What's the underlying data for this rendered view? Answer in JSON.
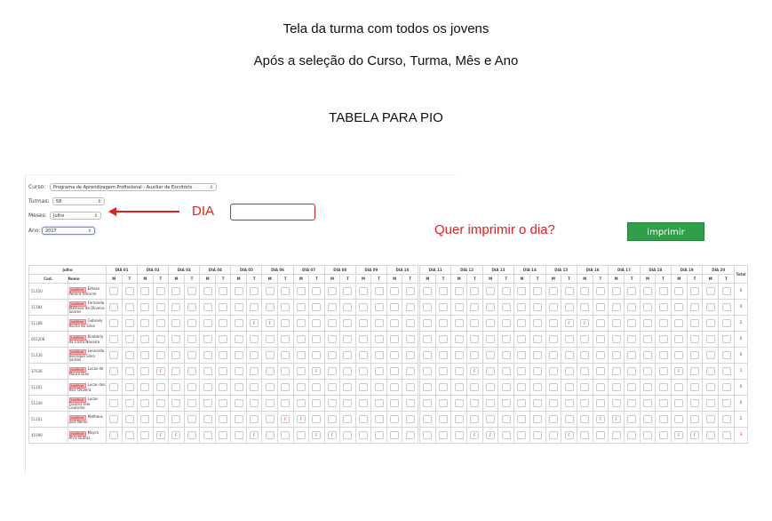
{
  "headings": {
    "line1": "Tela da turma com todos os jovens",
    "line2": "Após a seleção do Curso, Turma, Mês e Ano",
    "line3": "TABELA PARA PIO"
  },
  "filters": {
    "curso_label": "Curso:",
    "curso_value": "Programa de Aprendizagem Profissional - Auxiliar de Escritório",
    "turmas_label": "Turmas:",
    "turmas_value": "58",
    "meses_label": "Meses:",
    "meses_value": "Julho",
    "ano_label": "Ano:",
    "ano_value": "2017"
  },
  "annotation": {
    "dia_label": "DIA",
    "question": "Quer imprimir o dia?",
    "print_button": "imprimir"
  },
  "table": {
    "month": "Julho",
    "code_header": "Cod.",
    "name_header": "Nome",
    "total_header": "Total",
    "shift_m": "M",
    "shift_t": "T",
    "badge": "Justificar",
    "mark": "F",
    "left_days": [
      "DIA 01",
      "DIA 02",
      "DIA 03",
      "DIA 04",
      "DIA 05",
      "DIA 06",
      "DIA 07",
      "DIA 08",
      "DIA 09",
      "DIA 10"
    ],
    "right_days": [
      "DIA 11",
      "DIA 12",
      "DIA 13",
      "DIA 14",
      "DIA 15",
      "DIA 16",
      "DIA 17",
      "DIA 18",
      "DIA 19",
      "DIA 20"
    ],
    "students": [
      {
        "code": "51150",
        "name": "Edivan Pereira Amorim",
        "total": "0"
      },
      {
        "code": "51184",
        "name": "Fernando Matheus de Oliveira Soares",
        "total": "0"
      },
      {
        "code": "51188",
        "name": "Gabriely Rocha da Silva",
        "total": "2"
      },
      {
        "code": "001208",
        "name": "Kimberly da Costa Navarro",
        "total": "0"
      },
      {
        "code": "51126",
        "name": "Leonardo Henrique Silva Santos",
        "total": "0"
      },
      {
        "code": "37636",
        "name": "Lucas de Moura Dias",
        "total": "1"
      },
      {
        "code": "51201",
        "name": "Lucas dos Reis Oliveira",
        "total": "0"
      },
      {
        "code": "51249",
        "name": "Lucas Tavares Ielo Coutinho",
        "total": "0"
      },
      {
        "code": "51161",
        "name": "Matheus José Neres",
        "total": "2"
      },
      {
        "code": "41090",
        "name": "Mayra Alvis Dutras",
        "total": "3"
      }
    ]
  }
}
